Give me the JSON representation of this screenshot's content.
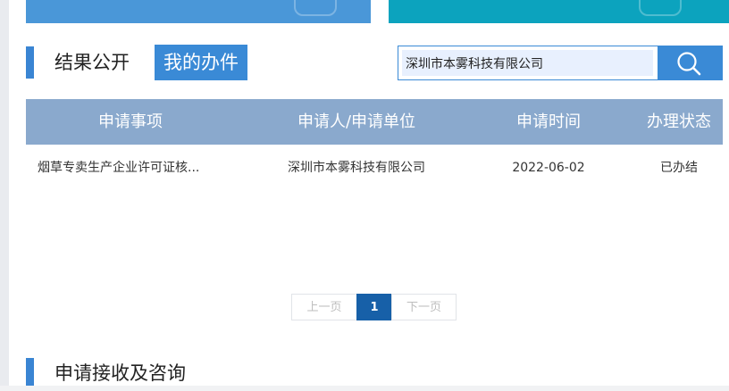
{
  "sections": {
    "results_title": "结果公开",
    "my_tab": "我的办件",
    "consult_title": "申请接收及咨询"
  },
  "search": {
    "value": "深圳市本雾科技有限公司",
    "icon": "search-icon"
  },
  "table": {
    "headers": [
      "申请事项",
      "申请人/申请单位",
      "申请时间",
      "办理状态"
    ],
    "rows": [
      {
        "item": "烟草专卖生产企业许可证核...",
        "applicant": "深圳市本雾科技有限公司",
        "date": "2022-06-02",
        "status": "已办结"
      }
    ]
  },
  "pagination": {
    "prev": "上一页",
    "current": "1",
    "next": "下一页"
  },
  "colors": {
    "accent": "#3a8ad6",
    "table_header": "#8aa9cd",
    "banner_left": "#4a97d8",
    "banner_right": "#0ca3be",
    "page_current": "#1760a8"
  }
}
